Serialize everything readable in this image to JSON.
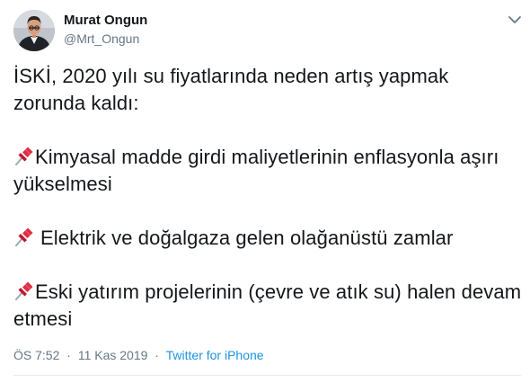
{
  "author": {
    "name": "Murat Ongun",
    "handle": "@Mrt_Ongun",
    "avatar_icon": "profile-photo"
  },
  "menu_icon": "chevron-down-icon",
  "tweet": {
    "intro": "İSKİ, 2020 yılı su fiyatlarında neden artış yapmak zorunda kaldı:",
    "points": [
      {
        "icon": "pushpin-icon",
        "text": "Kimyasal madde girdi maliyetlerinin enflasyonla aşırı yükselmesi"
      },
      {
        "icon": "pushpin-icon",
        "text": "Elektrik ve doğalgaza gelen olağanüstü zamlar"
      },
      {
        "icon": "pushpin-icon",
        "text": "Eski yatırım projelerinin (çevre ve atık su) halen devam etmesi"
      }
    ]
  },
  "meta": {
    "time": "ÖS 7:52",
    "separator": "·",
    "date": "11 Kas 2019",
    "source": "Twitter for iPhone"
  },
  "colors": {
    "text": "#14171a",
    "secondary": "#657786",
    "link": "#1b95e0",
    "pin": "#dd2e44",
    "divider": "#e6ecf0"
  }
}
